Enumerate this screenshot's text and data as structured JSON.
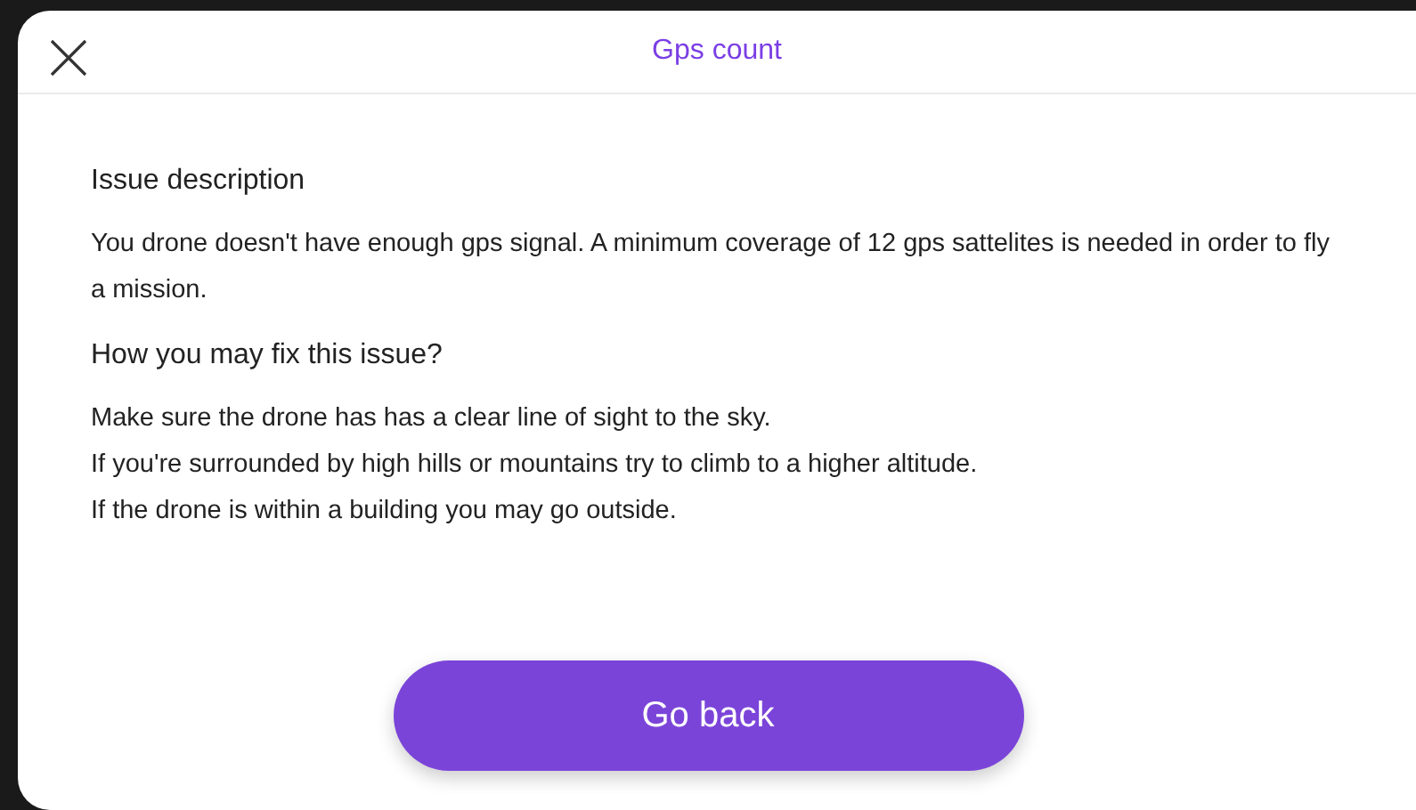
{
  "header": {
    "title": "Gps count"
  },
  "sections": [
    {
      "heading": "Issue description",
      "paragraphs": [
        "You drone doesn't have enough gps signal. A minimum coverage of 12 gps sattelites is needed in order to fly a mission."
      ]
    },
    {
      "heading": "How you may fix this issue?",
      "paragraphs": [
        "Make sure the drone has has a clear line of sight to the sky.",
        "If you're surrounded by high hills or mountains try to climb to a higher altitude.",
        "If the drone is within a building you may go outside."
      ]
    }
  ],
  "button": {
    "label": "Go back"
  }
}
